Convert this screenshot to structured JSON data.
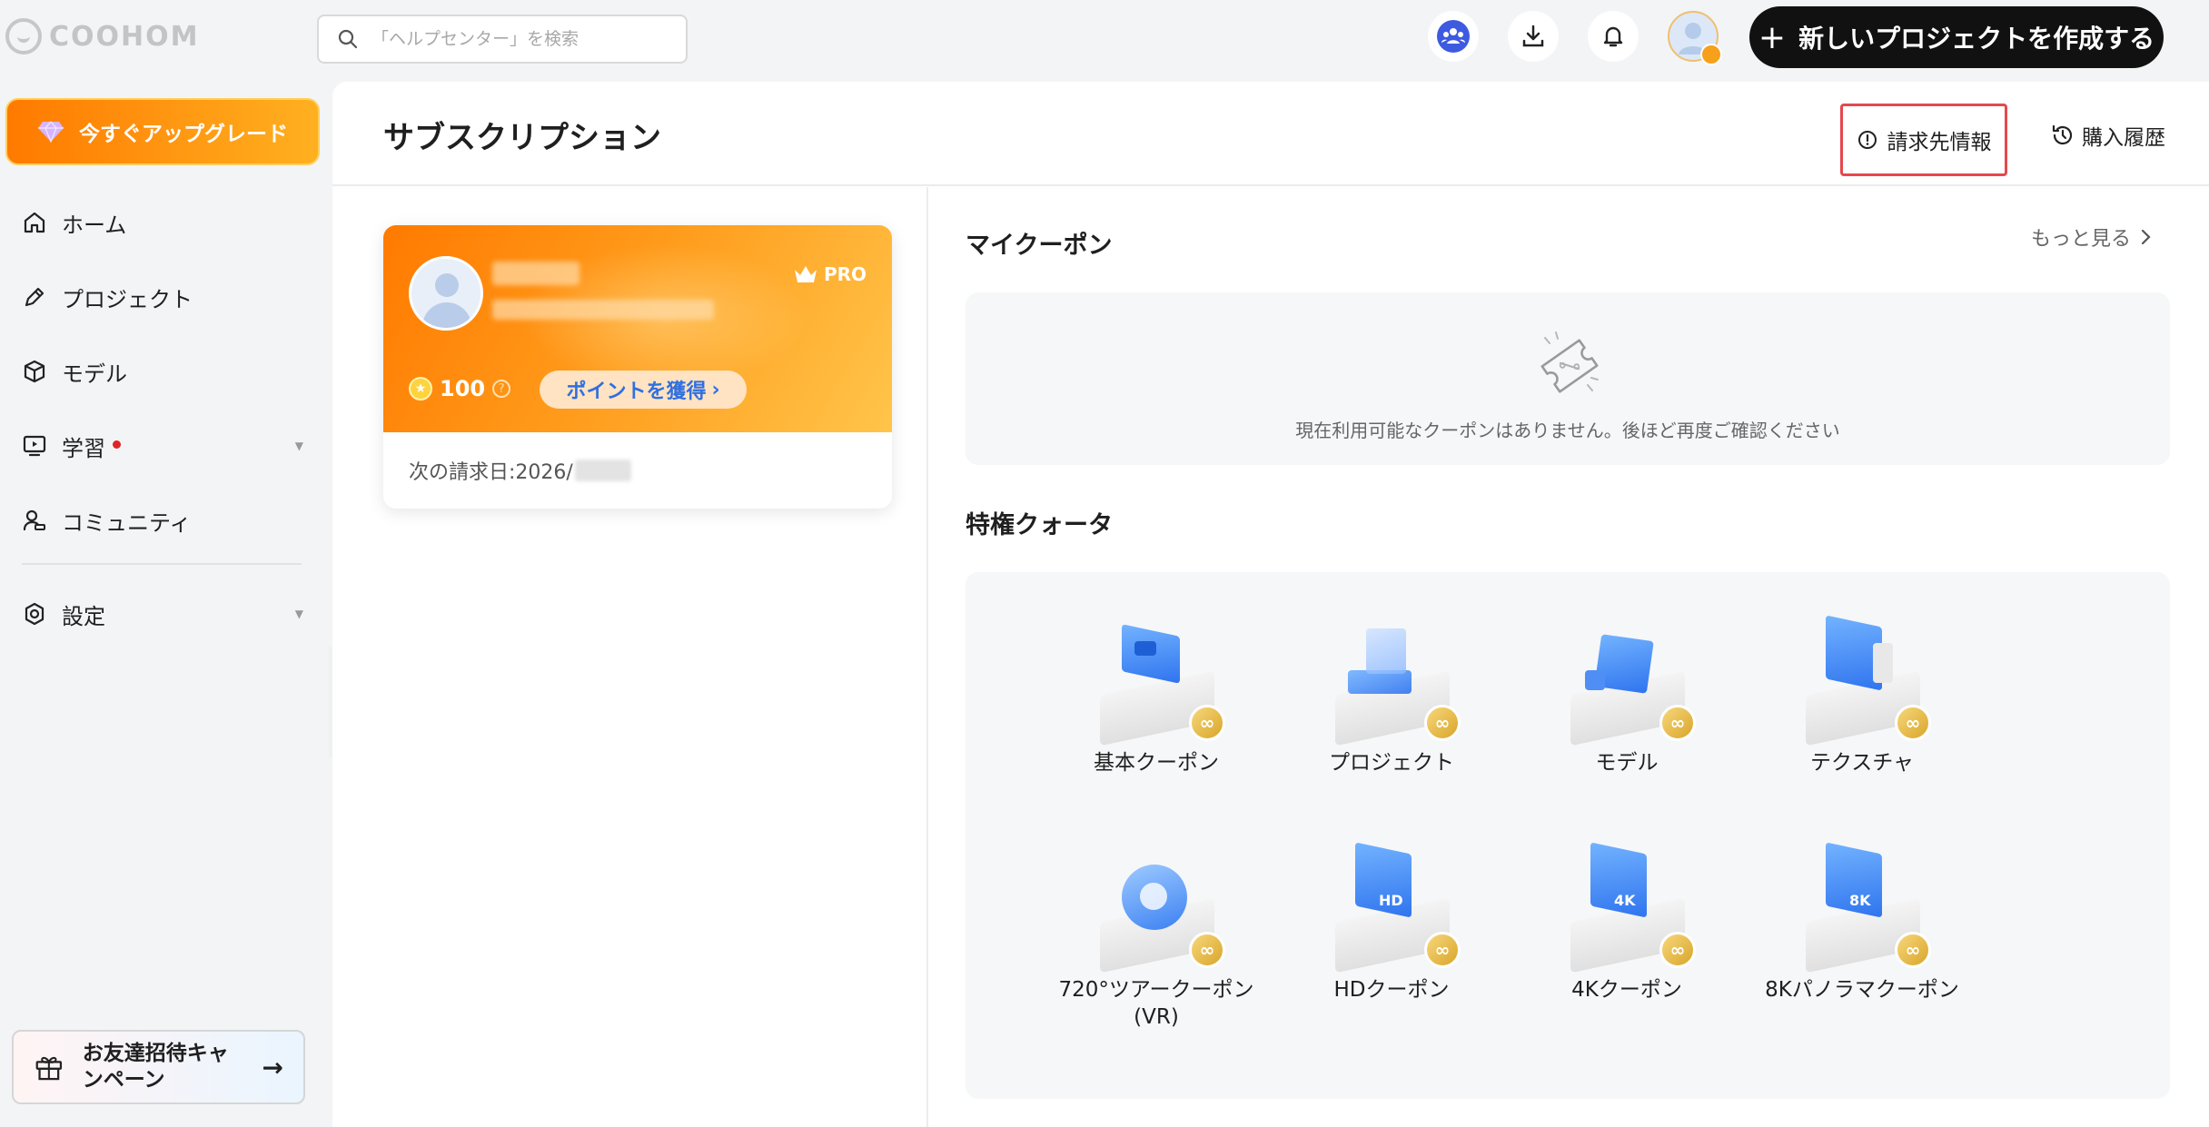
{
  "app": {
    "logo": "COOHOM"
  },
  "search": {
    "placeholder": "「ヘルプセンター」を検索"
  },
  "topbar": {
    "new_project": "新しいプロジェクトを作成する"
  },
  "sidebar": {
    "upgrade": "今すぐアップグレード",
    "items": [
      {
        "label": "ホーム"
      },
      {
        "label": "プロジェクト"
      },
      {
        "label": "モデル"
      },
      {
        "label": "学習"
      },
      {
        "label": "コミュニティ"
      },
      {
        "label": "設定"
      }
    ],
    "invite": "お友達招待キャンペーン"
  },
  "main": {
    "title": "サブスクリプション",
    "billing_info": "請求先情報",
    "purchase_history": "購入履歴",
    "card": {
      "badge": "PRO",
      "points": "100",
      "get_points": "ポイントを獲得",
      "next_billing": "次の請求日:2026/"
    },
    "coupons": {
      "title": "マイクーポン",
      "more": "もっと見る",
      "empty": "現在利用可能なクーポンはありません。後ほど再度ご確認ください"
    },
    "quota": {
      "title": "特権クォータ",
      "items": [
        {
          "label": "基本クーポン"
        },
        {
          "label": "プロジェクト"
        },
        {
          "label": "モデル"
        },
        {
          "label": "テクスチャ"
        },
        {
          "label": "720°ツアークーポン(VR)"
        },
        {
          "label": "HDクーポン",
          "badge": "HD"
        },
        {
          "label": "4Kクーポン",
          "badge": "4K"
        },
        {
          "label": "8Kパノラマクーポン",
          "badge": "8K"
        }
      ]
    }
  },
  "colors": {
    "accent": "#ff8a00",
    "primary_blue": "#2f74ef",
    "highlight_red": "#e5484d"
  }
}
